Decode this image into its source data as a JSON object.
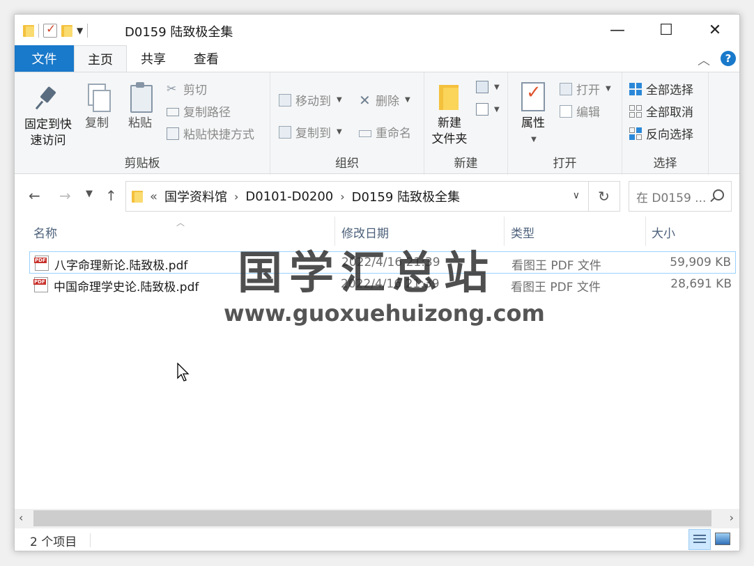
{
  "window": {
    "title": "D0159 陆致极全集",
    "controls": {
      "minimize": "—",
      "maximize": "☐",
      "close": "✕"
    }
  },
  "ribbon_tabs": {
    "file": "文件",
    "home": "主页",
    "share": "共享",
    "view": "查看"
  },
  "ribbon": {
    "clipboard": {
      "label": "剪贴板",
      "pin_line1": "固定到快",
      "pin_line2": "速访问",
      "copy": "复制",
      "paste": "粘贴",
      "cut": "剪切",
      "copy_path": "复制路径",
      "paste_shortcut": "粘贴快捷方式"
    },
    "organize": {
      "label": "组织",
      "move_to": "移动到",
      "copy_to": "复制到",
      "delete": "删除",
      "rename": "重命名"
    },
    "new": {
      "label": "新建",
      "new_folder_line1": "新建",
      "new_folder_line2": "文件夹"
    },
    "open": {
      "label": "打开",
      "properties": "属性",
      "open": "打开",
      "edit": "编辑"
    },
    "select": {
      "label": "选择",
      "select_all": "全部选择",
      "select_none": "全部取消",
      "invert": "反向选择"
    }
  },
  "address": {
    "overflow": "«",
    "crumbs": [
      "国学资料馆",
      "D0101-D0200",
      "D0159 陆致极全集"
    ],
    "search_placeholder": "在 D0159 ..."
  },
  "columns": {
    "name": "名称",
    "modified": "修改日期",
    "type": "类型",
    "size": "大小"
  },
  "files": [
    {
      "name": "八字命理新论.陆致极.pdf",
      "modified": "2022/4/16 21:39",
      "type": "看图王 PDF 文件",
      "size": "59,909 KB",
      "selected": true
    },
    {
      "name": "中国命理学史论.陆致极.pdf",
      "modified": "2022/4/16 21:39",
      "type": "看图王 PDF 文件",
      "size": "28,691 KB",
      "selected": false
    }
  ],
  "watermark": {
    "title": "国学汇总站",
    "url": "www.guoxuehuizong.com"
  },
  "status": {
    "item_count": "2 个项目"
  },
  "colors": {
    "accent": "#1979ca",
    "selection_border": "#99d1ff",
    "folder": "#f4c13d"
  }
}
